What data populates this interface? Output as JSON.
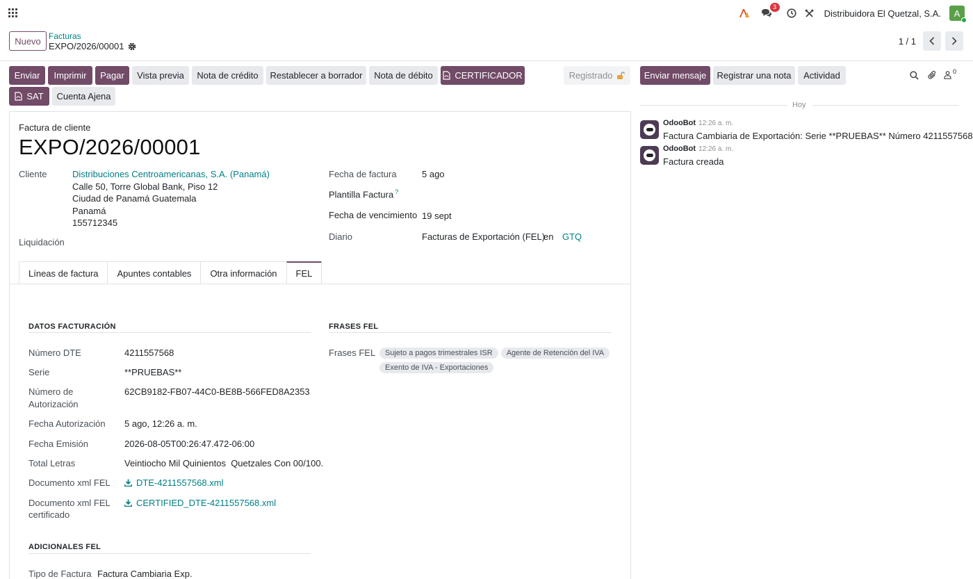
{
  "navbar": {
    "company": "Distribuidora El Quetzal, S.A.",
    "messages_count": "3",
    "avatar_letter": "A"
  },
  "control_panel": {
    "new_button": "Nuevo",
    "breadcrumb": "Facturas",
    "record_name": "EXPO/2026/00001",
    "pager": "1 / 1"
  },
  "buttons": {
    "enviar": "Enviar",
    "imprimir": "Imprimir",
    "pagar": "Pagar",
    "vista_previa": "Vista previa",
    "nota_credito": "Nota de crédito",
    "restablecer": "Restablecer a borrador",
    "nota_debito": "Nota de débito",
    "certificador": "CERTIFICADOR",
    "sat": "SAT",
    "cuenta_ajena": "Cuenta Ajena",
    "status": "Registrado"
  },
  "form": {
    "doc_type": "Factura de cliente",
    "title": "EXPO/2026/00001",
    "cliente_label": "Cliente",
    "cliente_name": "Distribuciones Centroamericanas, S.A. (Panamá)",
    "address": [
      "Calle 50, Torre Global Bank, Piso 12",
      "Ciudad de Panamá Guatemala",
      "Panamá",
      "155712345"
    ],
    "liquidacion_label": "Liquidación",
    "fecha_factura_label": "Fecha de factura",
    "fecha_factura": "5 ago",
    "plantilla_label": "Plantilla Factura",
    "plantilla_help": "?",
    "vencimiento_label": "Fecha de vencimiento",
    "vencimiento": "19 sept",
    "diario_label": "Diario",
    "diario": "Facturas de Exportación (FEL)",
    "en": "en",
    "currency": "GTQ"
  },
  "tabs": [
    "Líneas de factura",
    "Apuntes contables",
    "Otra información",
    "FEL"
  ],
  "fel": {
    "datos_title": "DATOS FACTURACIÓN",
    "frases_title": "FRASES FEL",
    "rows": {
      "numero_dte_label": "Número DTE",
      "numero_dte": "4211557568",
      "serie_label": "Serie",
      "serie": "**PRUEBAS**",
      "autorizacion_label_1": "Número de",
      "autorizacion_label_2": "Autorización",
      "autorizacion": "62CB9182-FB07-44C0-BE8B-566FED8A2353",
      "fecha_aut_label": "Fecha Autorización",
      "fecha_aut": "5 ago, 12:26 a. m.",
      "fecha_emision_label": "Fecha Emisión",
      "fecha_emision": "2026-08-05T00:26:47.472-06:00",
      "total_letras_label": "Total Letras",
      "total_letras": "Veintiocho Mil Quinientos  Quetzales Con 00/100.",
      "xml_label": "Documento xml FEL",
      "xml_file": "DTE-4211557568.xml",
      "xml_cert_label_1": "Documento xml FEL",
      "xml_cert_label_2": "certificado",
      "xml_cert_file": "CERTIFIED_DTE-4211557568.xml"
    },
    "frases_label": "Frases FEL",
    "frases": [
      "Sujeto a pagos trimestrales ISR",
      "Agente de Retención del IVA",
      "Exento de IVA - Exportaciones"
    ],
    "adicionales_title": "ADICIONALES FEL",
    "tipo_label": "Tipo de Factura",
    "tipo": "Factura Cambiaria Exp."
  },
  "chatter": {
    "send_message": "Enviar mensaje",
    "log_note": "Registrar una nota",
    "activity": "Actividad",
    "followers_count": "0",
    "today": "Hoy",
    "messages": [
      {
        "author": "OdooBot",
        "time": "12:26 a. m.",
        "body": "Factura Cambiaria de Exportación: Serie **PRUEBAS** Número 4211557568"
      },
      {
        "author": "OdooBot",
        "time": "12:26 a. m.",
        "body": "Factura creada"
      }
    ]
  },
  "colors": {
    "primary": "#714b67",
    "link": "#017e84",
    "badge": "#d9363e"
  }
}
